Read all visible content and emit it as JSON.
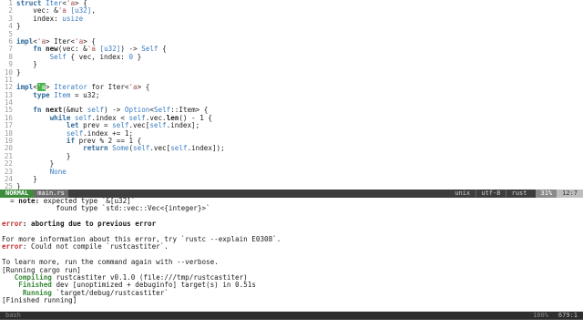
{
  "editor": {
    "lines": [
      {
        "n": "1",
        "parts": [
          [
            "kw",
            "struct"
          ],
          [
            "",
            " "
          ],
          [
            "ty",
            "Iter"
          ],
          [
            "",
            "<"
          ],
          [
            "lt",
            "'a"
          ],
          [
            "",
            "> {"
          ]
        ]
      },
      {
        "n": "2",
        "parts": [
          [
            "",
            "    vec: &"
          ],
          [
            "lt",
            "'a"
          ],
          [
            "",
            " "
          ],
          [
            "ty",
            "[u32]"
          ],
          [
            "",
            ","
          ]
        ]
      },
      {
        "n": "3",
        "parts": [
          [
            "",
            "    index: "
          ],
          [
            "ty",
            "usize"
          ]
        ]
      },
      {
        "n": "4",
        "parts": [
          [
            "",
            "}"
          ]
        ]
      },
      {
        "n": "5",
        "parts": [
          [
            "",
            ""
          ]
        ]
      },
      {
        "n": "6",
        "parts": [
          [
            "kw",
            "impl"
          ],
          [
            "",
            "<"
          ],
          [
            "lt",
            "'a"
          ],
          [
            "",
            "> Iter<"
          ],
          [
            "lt",
            "'a"
          ],
          [
            "",
            "> {"
          ]
        ]
      },
      {
        "n": "7",
        "parts": [
          [
            "",
            "    "
          ],
          [
            "kw",
            "fn"
          ],
          [
            "",
            " "
          ],
          [
            "fn",
            "new"
          ],
          [
            "",
            "(vec: &"
          ],
          [
            "lt",
            "'a"
          ],
          [
            "",
            " "
          ],
          [
            "ty",
            "[u32]"
          ],
          [
            "",
            ") -> "
          ],
          [
            "ty",
            "Self"
          ],
          [
            "",
            " {"
          ]
        ]
      },
      {
        "n": "8",
        "parts": [
          [
            "",
            "        "
          ],
          [
            "ty",
            "Self"
          ],
          [
            "",
            " { vec, index: "
          ],
          [
            "num",
            "0"
          ],
          [
            "",
            " }"
          ]
        ]
      },
      {
        "n": "9",
        "parts": [
          [
            "",
            "    }"
          ]
        ]
      },
      {
        "n": "10",
        "parts": [
          [
            "",
            "}"
          ]
        ]
      },
      {
        "n": "11",
        "parts": [
          [
            "",
            ""
          ]
        ]
      },
      {
        "n": "12",
        "parts": [
          [
            "kw",
            "impl"
          ],
          [
            "",
            "<"
          ],
          [
            "cur",
            "'a"
          ],
          [
            "",
            "> "
          ],
          [
            "ty",
            "Iterator"
          ],
          [
            "",
            " for Iter<"
          ],
          [
            "lt",
            "'a"
          ],
          [
            "",
            "> {"
          ]
        ]
      },
      {
        "n": "13",
        "parts": [
          [
            "",
            "    "
          ],
          [
            "kw",
            "type"
          ],
          [
            "",
            " "
          ],
          [
            "ty",
            "Item"
          ],
          [
            "",
            " = u32;"
          ]
        ]
      },
      {
        "n": "14",
        "parts": [
          [
            "",
            ""
          ]
        ]
      },
      {
        "n": "15",
        "parts": [
          [
            "",
            "    "
          ],
          [
            "kw",
            "fn"
          ],
          [
            "",
            " "
          ],
          [
            "fn",
            "next"
          ],
          [
            "",
            "(&mut "
          ],
          [
            "sf",
            "self"
          ],
          [
            "",
            ") -> "
          ],
          [
            "ty",
            "Option"
          ],
          [
            "",
            "<"
          ],
          [
            "ty",
            "Self"
          ],
          [
            "",
            "::Item> {"
          ]
        ]
      },
      {
        "n": "16",
        "parts": [
          [
            "",
            "        "
          ],
          [
            "kw",
            "while"
          ],
          [
            "",
            " "
          ],
          [
            "sf",
            "self"
          ],
          [
            "",
            ".index < "
          ],
          [
            "sf",
            "self"
          ],
          [
            "",
            ".vec."
          ],
          [
            "fn",
            "len"
          ],
          [
            "",
            "() - 1 {"
          ]
        ]
      },
      {
        "n": "17",
        "parts": [
          [
            "",
            "            "
          ],
          [
            "kw",
            "let"
          ],
          [
            "",
            " prev = "
          ],
          [
            "sf",
            "self"
          ],
          [
            "",
            ".vec["
          ],
          [
            "sf",
            "self"
          ],
          [
            "",
            ".index];"
          ]
        ]
      },
      {
        "n": "18",
        "parts": [
          [
            "",
            "            "
          ],
          [
            "sf",
            "self"
          ],
          [
            "",
            ".index += 1;"
          ]
        ]
      },
      {
        "n": "19",
        "parts": [
          [
            "",
            "            "
          ],
          [
            "kw",
            "if"
          ],
          [
            "",
            " prev % 2 == 1 {"
          ]
        ]
      },
      {
        "n": "20",
        "parts": [
          [
            "",
            "                "
          ],
          [
            "kw",
            "return"
          ],
          [
            "",
            " "
          ],
          [
            "ty",
            "Some"
          ],
          [
            "",
            "("
          ],
          [
            "sf",
            "self"
          ],
          [
            "",
            ".vec["
          ],
          [
            "sf",
            "self"
          ],
          [
            "",
            ".index]);"
          ]
        ]
      },
      {
        "n": "21",
        "parts": [
          [
            "",
            "            }"
          ]
        ]
      },
      {
        "n": "22",
        "parts": [
          [
            "",
            "        }"
          ]
        ]
      },
      {
        "n": "23",
        "parts": [
          [
            "",
            "        "
          ],
          [
            "ty",
            "None"
          ]
        ]
      },
      {
        "n": "24",
        "parts": [
          [
            "",
            "    }"
          ]
        ]
      },
      {
        "n": "25",
        "parts": [
          [
            "",
            "}"
          ]
        ]
      }
    ]
  },
  "statusline": {
    "mode": "NORMAL",
    "filename": "main.rs",
    "format": "unix",
    "encoding": "utf-8",
    "filetype": "rust",
    "percent": "31%",
    "position": "12:7",
    "sep": "|"
  },
  "terminal": {
    "lines": [
      [
        [
          "",
          "  = "
        ],
        [
          "note",
          "note:"
        ],
        [
          "",
          " expected type `&[u32]`"
        ]
      ],
      [
        [
          "",
          "             found type `std::vec::Vec<{integer}>`"
        ]
      ],
      [
        [
          "",
          ""
        ]
      ],
      [
        [
          "err",
          "error"
        ],
        [
          "note",
          ": aborting due to previous error"
        ]
      ],
      [
        [
          "",
          ""
        ]
      ],
      [
        [
          "",
          "For more information about this error, try `rustc --explain E0308`."
        ]
      ],
      [
        [
          "err",
          "error"
        ],
        [
          "",
          ": Could not compile `rustcastiter`."
        ]
      ],
      [
        [
          "",
          ""
        ]
      ],
      [
        [
          "",
          "To learn more, run the command again with --verbose."
        ]
      ],
      [
        [
          "",
          "[Running cargo run]"
        ]
      ],
      [
        [
          "grn",
          "   Compiling"
        ],
        [
          "",
          " rustcastiter v0.1.0 (file:///tmp/rustcastiter)"
        ]
      ],
      [
        [
          "grn",
          "    Finished"
        ],
        [
          "",
          " dev [unoptimized + debuginfo] target(s) in 0.51s"
        ]
      ],
      [
        [
          "grn",
          "     Running"
        ],
        [
          "",
          " `target/debug/rustcastiter`"
        ]
      ],
      [
        [
          "",
          "[Finished running]"
        ]
      ]
    ]
  },
  "tmux": {
    "window": "bash",
    "percent": "100%",
    "position": "679:1"
  }
}
